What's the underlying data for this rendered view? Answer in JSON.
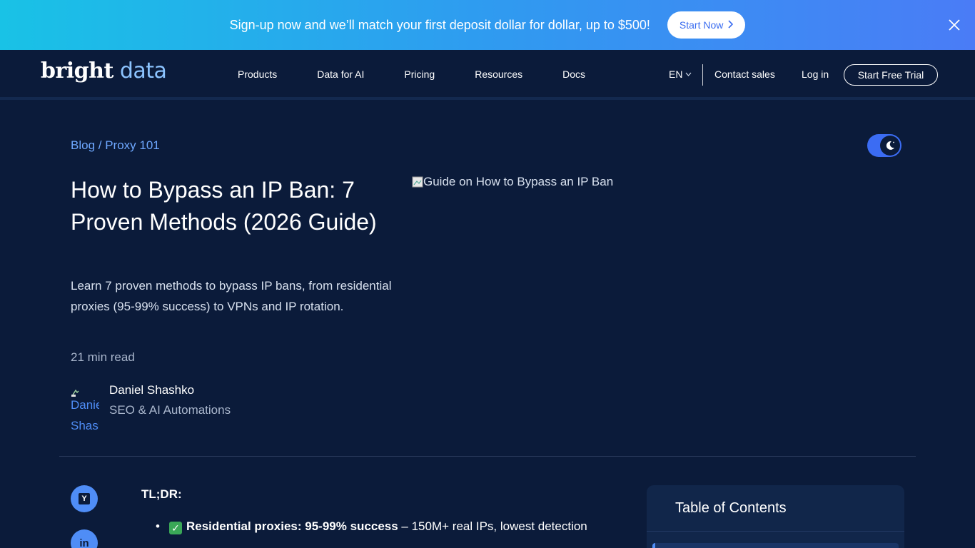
{
  "promo": {
    "text": "Sign-up now and we’ll match your first deposit dollar for dollar, up to $500!",
    "button_label": "Start Now",
    "chevron_icon": "chevron-right-icon",
    "close_icon": "close-icon"
  },
  "header": {
    "logo_bold": "bright",
    "logo_light": " data",
    "nav": [
      "Products",
      "Data for AI",
      "Pricing",
      "Resources",
      "Docs"
    ],
    "language": "EN",
    "contact": "Contact sales",
    "login": "Log in",
    "trial": "Start Free Trial"
  },
  "article": {
    "breadcrumb": "Blog / Proxy 101",
    "title": "How to Bypass an IP Ban: 7 Proven Methods (2026 Guide)",
    "subtitle": "Learn 7 proven methods to bypass IP bans, from residential proxies (95-99% success) to VPNs and IP rotation.",
    "read_time": "21 min read",
    "author_avatar_alt": "Daniel Shashko",
    "author_name": "Daniel Shashko",
    "author_role": "SEO & AI Automations",
    "hero_alt": "Guide on How to Bypass an IP Ban",
    "tldr": "TL;DR:",
    "bullet_bold": "Residential proxies: 95-99% success",
    "bullet_rest": " – 150M+ real IPs, lowest detection"
  },
  "theme_toggle": {
    "icon": "moon-icon"
  },
  "share": [
    {
      "icon": "ycombinator-icon",
      "label": "Y"
    },
    {
      "icon": "linkedin-icon",
      "label": "in"
    }
  ],
  "toc": {
    "title": "Table of Contents"
  },
  "colors": {
    "background": "#0b1b3a",
    "accent": "#4f8df6",
    "link": "#6ea8ff"
  }
}
